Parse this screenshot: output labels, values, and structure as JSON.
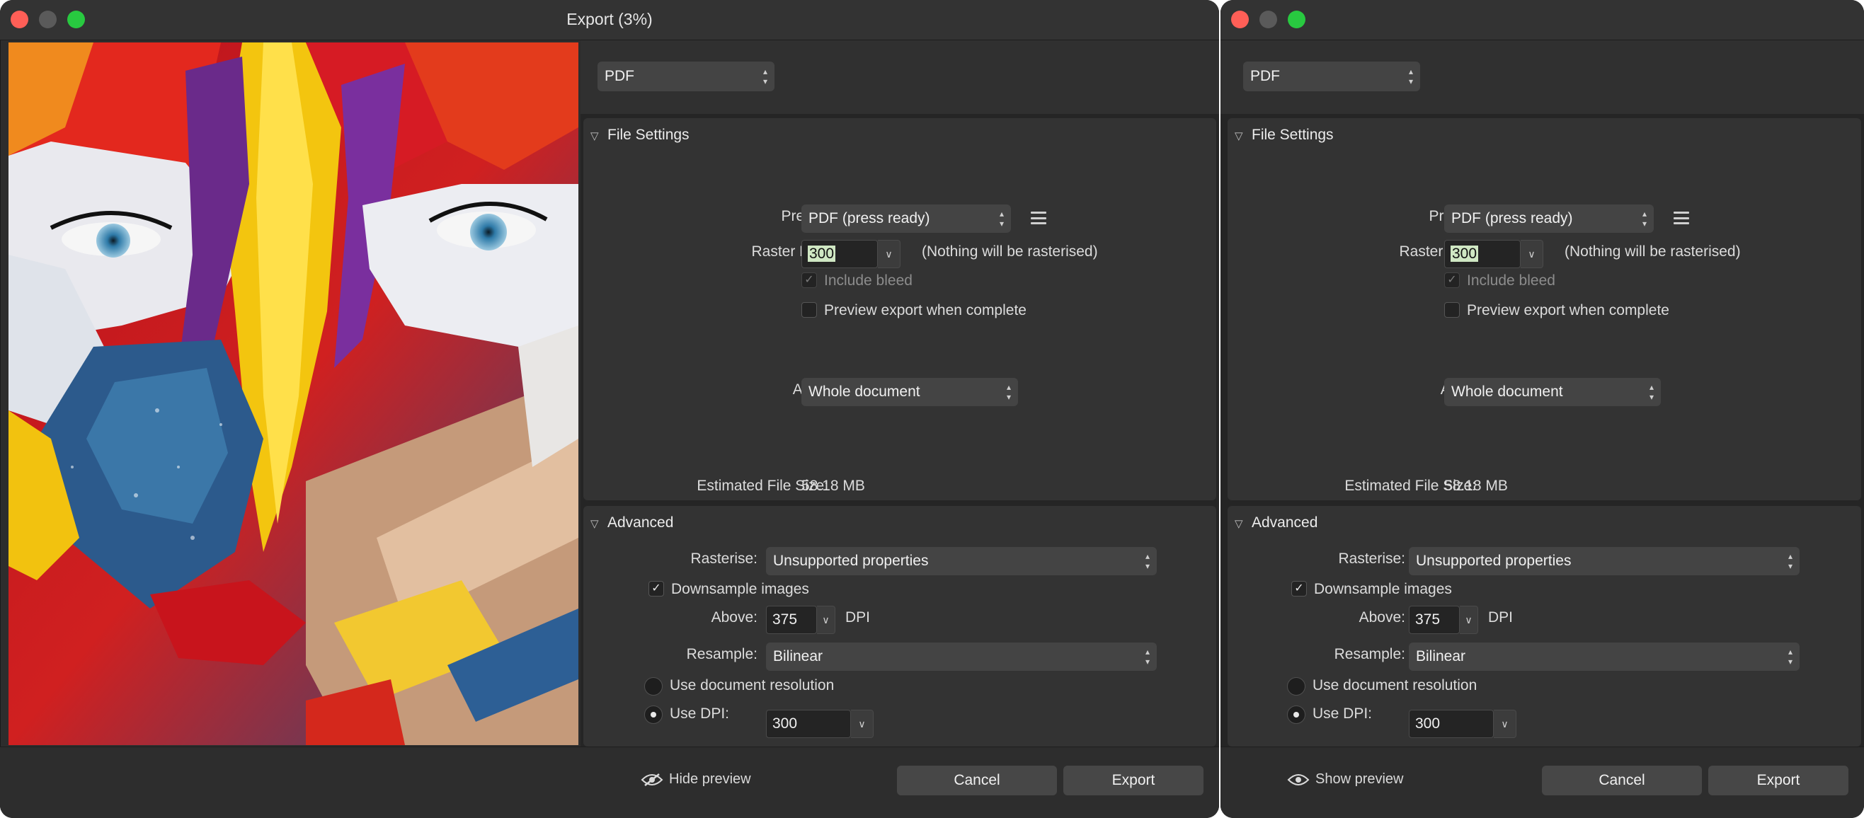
{
  "left_window": {
    "title": "Export (3%)",
    "format": "PDF",
    "preview_toggle": "Hide preview"
  },
  "right_window": {
    "title": "",
    "format": "PDF",
    "preview_toggle": "Show preview"
  },
  "file_settings": {
    "header": "File Settings",
    "preset_label": "Preset:",
    "preset_value": "PDF (press ready)",
    "raster_dpi_label": "Raster DPI:",
    "raster_dpi_value": "300",
    "raster_note": "(Nothing will be rasterised)",
    "include_bleed": "Include bleed",
    "preview_export": "Preview export when complete",
    "area_label": "Area:",
    "area_value": "Whole document",
    "est_size_label": "Estimated File Size:",
    "est_size_value": "58.18 MB"
  },
  "advanced": {
    "header": "Advanced",
    "rasterise_label": "Rasterise:",
    "rasterise_value": "Unsupported properties",
    "downsample": "Downsample images",
    "above_label": "Above:",
    "above_value": "375",
    "above_unit": "DPI",
    "resample_label": "Resample:",
    "resample_value": "Bilinear",
    "use_doc_res": "Use document resolution",
    "use_dpi_label": "Use DPI:",
    "use_dpi_value": "300"
  },
  "buttons": {
    "cancel": "Cancel",
    "export": "Export"
  },
  "colors": {
    "close": "#ff5f57",
    "maximize": "#28c940",
    "selection": "#cfe7c3"
  }
}
